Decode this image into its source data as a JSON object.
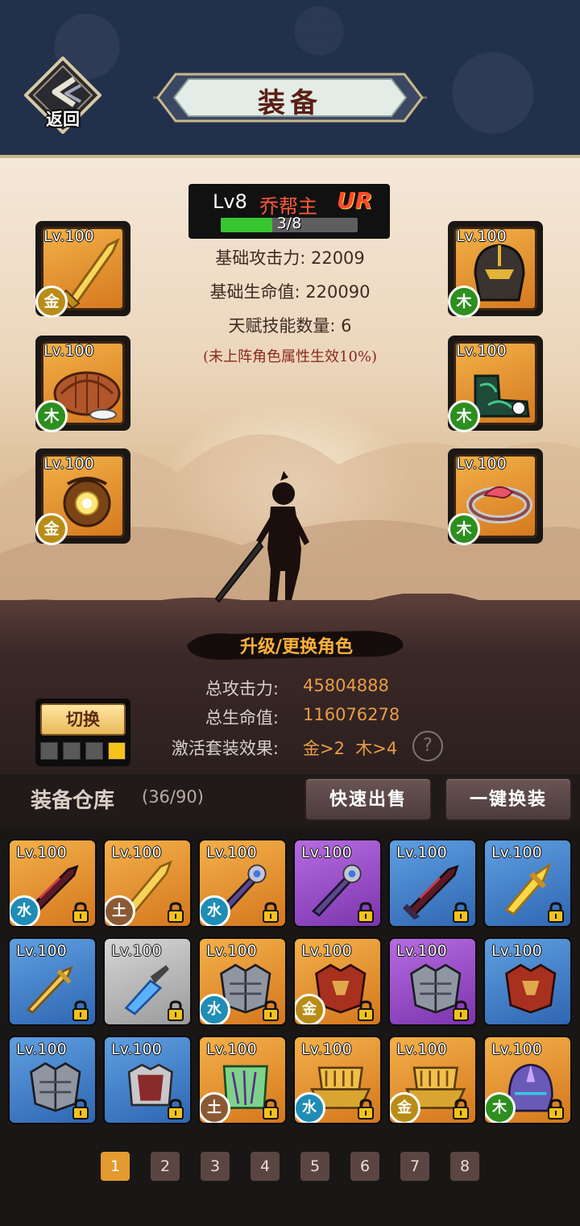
{
  "header": {
    "back_label": "返回",
    "title": "装备"
  },
  "hero": {
    "level": "Lv8",
    "name": "乔帮主",
    "rarity": "UR",
    "progress_text": "3/8",
    "progress_fraction": 0.375,
    "base_attack": "基础攻击力: 22009",
    "base_hp": "基础生命值: 220090",
    "talent_count": "天赋技能数量: 6",
    "note": "(未上阵角色属性生效10%)"
  },
  "equipped_left": [
    {
      "level": "Lv.100",
      "element": "金",
      "icon": "golden-sword-icon"
    },
    {
      "level": "Lv.100",
      "element": "木",
      "icon": "turtle-shell-helmet-icon"
    },
    {
      "level": "Lv.100",
      "element": "金",
      "icon": "amulet-icon"
    }
  ],
  "equipped_right": [
    {
      "level": "Lv.100",
      "element": "木",
      "icon": "dark-helmet-icon"
    },
    {
      "level": "Lv.100",
      "element": "木",
      "icon": "jade-boots-icon"
    },
    {
      "level": "Lv.100",
      "element": "木",
      "icon": "dragon-bracelet-icon"
    }
  ],
  "upgrade_label": "升级/更换角色",
  "totals": {
    "attack_label": "总攻击力:",
    "attack_value": "45804888",
    "hp_label": "总生命值:",
    "hp_value": "116076278",
    "set_label": "激活套装效果:",
    "set_value": "金>2  木>4",
    "help_glyph": "?"
  },
  "switch_label": "切换",
  "loadouts": {
    "count": 4,
    "active_index": 3
  },
  "warehouse": {
    "title": "装备仓库",
    "count": "(36/90)",
    "quick_sell": "快速出售",
    "one_click_equip": "一键换装"
  },
  "items": [
    {
      "level": "Lv.100",
      "rarity": "orange",
      "element": "水",
      "icon": "dark-blade-icon",
      "locked": true
    },
    {
      "level": "Lv.100",
      "rarity": "orange",
      "element": "土",
      "icon": "golden-sword-icon",
      "locked": true
    },
    {
      "level": "Lv.100",
      "rarity": "orange",
      "element": "水",
      "icon": "star-sword-icon",
      "locked": true
    },
    {
      "level": "Lv.100",
      "rarity": "purple",
      "element": "",
      "icon": "star-sword-icon",
      "locked": true
    },
    {
      "level": "Lv.100",
      "rarity": "blue",
      "element": "",
      "icon": "dark-blade-icon",
      "locked": true
    },
    {
      "level": "Lv.100",
      "rarity": "blue",
      "element": "",
      "icon": "gold-blade-icon",
      "locked": true
    },
    {
      "level": "Lv.100",
      "rarity": "blue",
      "element": "",
      "icon": "gold-sword-icon",
      "locked": true
    },
    {
      "level": "Lv.100",
      "rarity": "gray",
      "element": "",
      "icon": "crystal-sword-icon",
      "locked": true
    },
    {
      "level": "Lv.100",
      "rarity": "orange",
      "element": "水",
      "icon": "steel-armor-icon",
      "locked": true
    },
    {
      "level": "Lv.100",
      "rarity": "orange",
      "element": "金",
      "icon": "red-armor-icon",
      "locked": true
    },
    {
      "level": "Lv.100",
      "rarity": "purple",
      "element": "",
      "icon": "steel-armor-icon",
      "locked": true
    },
    {
      "level": "Lv.100",
      "rarity": "blue",
      "element": "",
      "icon": "red-armor-icon",
      "locked": false
    },
    {
      "level": "Lv.100",
      "rarity": "blue",
      "element": "",
      "icon": "steel-armor-icon",
      "locked": true
    },
    {
      "level": "Lv.100",
      "rarity": "blue",
      "element": "",
      "icon": "silver-armor-icon",
      "locked": true
    },
    {
      "level": "Lv.100",
      "rarity": "orange",
      "element": "土",
      "icon": "jade-vest-icon",
      "locked": true
    },
    {
      "level": "Lv.100",
      "rarity": "orange",
      "element": "水",
      "icon": "gold-boat-icon",
      "locked": true
    },
    {
      "level": "Lv.100",
      "rarity": "orange",
      "element": "金",
      "icon": "gold-boat-icon",
      "locked": true
    },
    {
      "level": "Lv.100",
      "rarity": "orange",
      "element": "木",
      "icon": "crystal-helmet-icon",
      "locked": true
    }
  ],
  "pages": [
    "1",
    "2",
    "3",
    "4",
    "5",
    "6",
    "7",
    "8"
  ],
  "current_page": "1",
  "colors": {
    "header_bg": "#22314b",
    "accent_orange": "#e99c47",
    "rarity_orange": "#e59433",
    "rarity_purple": "#9a50c8",
    "rarity_blue": "#4580c8",
    "rarity_gray": "#b8b8b8"
  }
}
